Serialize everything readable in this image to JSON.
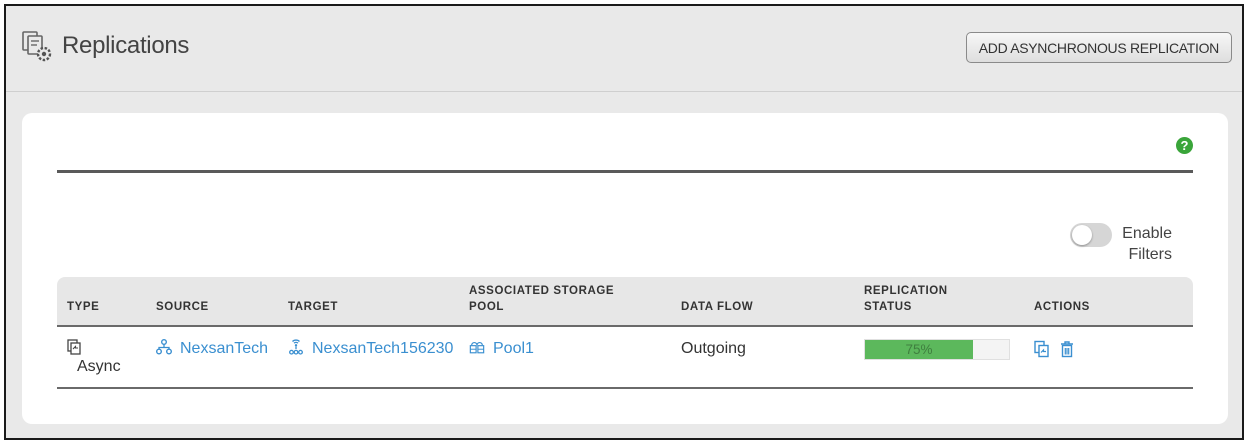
{
  "header": {
    "title": "Replications",
    "add_button_label": "ADD ASYNCHRONOUS REPLICATION",
    "icon": "replications-settings-icon"
  },
  "help": {
    "glyph": "?",
    "icon": "help-icon",
    "color": "#3aa53a"
  },
  "filters": {
    "label_line1": "Enable",
    "label_line2": "Filters",
    "enabled": false
  },
  "table": {
    "columns": {
      "type": "TYPE",
      "source": "SOURCE",
      "target": "TARGET",
      "pool_line1": "ASSOCIATED STORAGE",
      "pool_line2": "POOL",
      "data_flow": "DATA FLOW",
      "status_line1": "REPLICATION",
      "status_line2": "STATUS",
      "actions": "ACTIONS"
    },
    "rows": [
      {
        "type": "Async",
        "source": "NexsanTech",
        "target": "NexsanTech156230",
        "pool": "Pool1",
        "data_flow": "Outgoing",
        "progress": 0.75,
        "progress_label": "75%"
      }
    ]
  },
  "colors": {
    "link": "#3a8fd0",
    "progress_fill": "#5cb85c",
    "background": "#e9e9e9"
  }
}
